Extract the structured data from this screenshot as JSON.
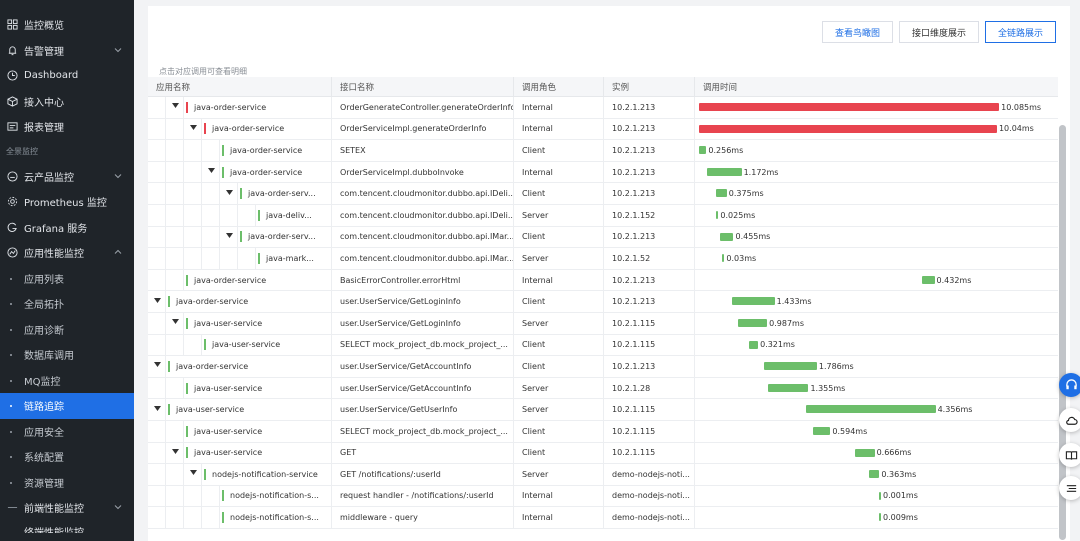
{
  "sidebar": {
    "items": [
      {
        "label": "监控概览",
        "icon": "grid-icon",
        "chevron": false,
        "type": "top"
      },
      {
        "label": "告警管理",
        "icon": "bell-icon",
        "chevron": true,
        "type": "top"
      },
      {
        "label": "Dashboard",
        "icon": "clock-icon",
        "chevron": false,
        "type": "top"
      },
      {
        "label": "接入中心",
        "icon": "cube-icon",
        "chevron": false,
        "type": "top"
      },
      {
        "label": "报表管理",
        "icon": "report-icon",
        "chevron": false,
        "type": "top"
      }
    ],
    "section_label": "全景监控",
    "items2": [
      {
        "label": "云产品监控",
        "icon": "cloud-box-icon",
        "chevron": true
      },
      {
        "label": "Prometheus 监控",
        "icon": "gear-icon",
        "chevron": false
      },
      {
        "label": "Grafana 服务",
        "icon": "grafana-icon",
        "chevron": false
      },
      {
        "label": "应用性能监控",
        "icon": "apm-icon",
        "chevron": true
      }
    ],
    "subitems": [
      "应用列表",
      "全局拓扑",
      "应用诊断",
      "数据库调用",
      "MQ监控",
      "链路追踪",
      "应用安全",
      "系统配置",
      "资源管理"
    ],
    "active_sub": "链路追踪",
    "bottom_item": {
      "label": "前端性能监控",
      "icon": "rum-icon",
      "chevron": true
    },
    "cut_item": {
      "label": "终端性能监控"
    }
  },
  "toolbar": {
    "overview_btn": "查看鸟瞰图",
    "interface_btn": "接口维度展示",
    "fulllink_btn": "全链路展示"
  },
  "hint": "点击对应调用可查看明细",
  "table": {
    "headers": [
      "应用名称",
      "接口名称",
      "调用角色",
      "实例",
      "调用时间"
    ],
    "rows": [
      {
        "app": "java-order-service",
        "iface": "OrderGenerateController.generateOrderInfo",
        "role": "Internal",
        "inst": "10.2.1.213",
        "dur": "10.085ms"
      },
      {
        "app": "java-order-service",
        "iface": "OrderServiceImpl.generateOrderInfo",
        "role": "Internal",
        "inst": "10.2.1.213",
        "dur": "10.04ms"
      },
      {
        "app": "java-order-service",
        "iface": "SETEX",
        "role": "Client",
        "inst": "10.2.1.213",
        "dur": "0.256ms"
      },
      {
        "app": "java-order-service",
        "iface": "OrderServiceImpl.dubboInvoke",
        "role": "Internal",
        "inst": "10.2.1.213",
        "dur": "1.172ms"
      },
      {
        "app": "java-order-serv...",
        "iface": "com.tencent.cloudmonitor.dubbo.api.IDeli...",
        "role": "Client",
        "inst": "10.2.1.213",
        "dur": "0.375ms"
      },
      {
        "app": "java-deliv...",
        "iface": "com.tencent.cloudmonitor.dubbo.api.IDeli...",
        "role": "Server",
        "inst": "10.2.1.152",
        "dur": "0.025ms"
      },
      {
        "app": "java-order-serv...",
        "iface": "com.tencent.cloudmonitor.dubbo.api.IMar...",
        "role": "Client",
        "inst": "10.2.1.213",
        "dur": "0.455ms"
      },
      {
        "app": "java-mark...",
        "iface": "com.tencent.cloudmonitor.dubbo.api.IMar...",
        "role": "Server",
        "inst": "10.2.1.52",
        "dur": "0.03ms"
      },
      {
        "app": "java-order-service",
        "iface": "BasicErrorController.errorHtml",
        "role": "Internal",
        "inst": "10.2.1.213",
        "dur": "0.432ms"
      },
      {
        "app": "java-order-service",
        "iface": "user.UserService/GetLoginInfo",
        "role": "Client",
        "inst": "10.2.1.213",
        "dur": "1.433ms"
      },
      {
        "app": "java-user-service",
        "iface": "user.UserService/GetLoginInfo",
        "role": "Server",
        "inst": "10.2.1.115",
        "dur": "0.987ms"
      },
      {
        "app": "java-user-service",
        "iface": "SELECT mock_project_db.mock_project_...",
        "role": "Client",
        "inst": "10.2.1.115",
        "dur": "0.321ms"
      },
      {
        "app": "java-order-service",
        "iface": "user.UserService/GetAccountInfo",
        "role": "Client",
        "inst": "10.2.1.213",
        "dur": "1.786ms"
      },
      {
        "app": "java-user-service",
        "iface": "user.UserService/GetAccountInfo",
        "role": "Server",
        "inst": "10.2.1.28",
        "dur": "1.355ms"
      },
      {
        "app": "java-user-service",
        "iface": "user.UserService/GetUserInfo",
        "role": "Server",
        "inst": "10.2.1.115",
        "dur": "4.356ms"
      },
      {
        "app": "java-user-service",
        "iface": "SELECT mock_project_db.mock_project_...",
        "role": "Client",
        "inst": "10.2.1.115",
        "dur": "0.594ms"
      },
      {
        "app": "java-user-service",
        "iface": "GET",
        "role": "Client",
        "inst": "10.2.1.115",
        "dur": "0.666ms"
      },
      {
        "app": "nodejs-notification-service",
        "iface": "GET /notifications/:userId",
        "role": "Server",
        "inst": "demo-nodejs-noti...",
        "dur": "0.363ms"
      },
      {
        "app": "nodejs-notification-s...",
        "iface": "request handler - /notifications/:userId",
        "role": "Internal",
        "inst": "demo-nodejs-noti...",
        "dur": "0.001ms"
      },
      {
        "app": "nodejs-notification-s...",
        "iface": "middleware - query",
        "role": "Internal",
        "inst": "demo-nodejs-noti...",
        "dur": "0.009ms"
      }
    ]
  },
  "colors": {
    "error": "#e8444f",
    "ok": "#6cbe6a",
    "accent": "#1f6fe5"
  },
  "floating_tools": [
    "headset-icon",
    "cloud-icon",
    "book-icon",
    "list-icon"
  ]
}
